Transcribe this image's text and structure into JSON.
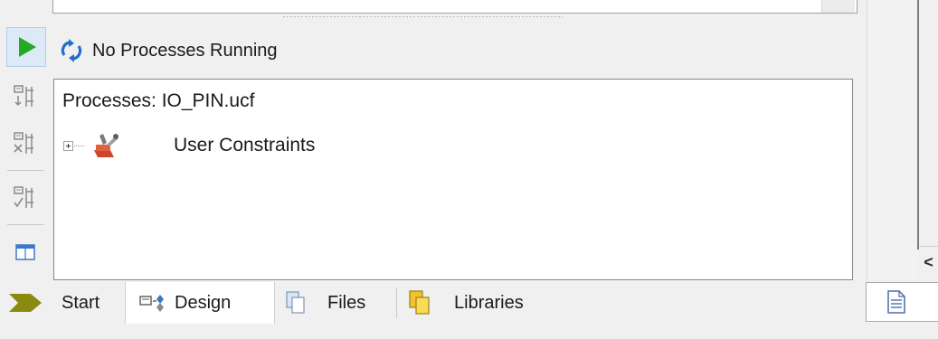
{
  "status": {
    "text": "No Processes Running",
    "icon": "refresh-icon"
  },
  "toolbar": {
    "items": [
      {
        "name": "run-button",
        "icon": "play-icon"
      },
      {
        "name": "rerun-button",
        "icon": "rerun-icon"
      },
      {
        "name": "rerun-all-button",
        "icon": "rerun-all-icon"
      },
      {
        "name": "stop-button",
        "icon": "stop-icon"
      },
      {
        "name": "view-button",
        "icon": "panel-icon"
      }
    ]
  },
  "processes": {
    "title": "Processes: IO_PIN.ucf",
    "items": [
      {
        "label": "User Constraints",
        "icon": "user-constraints-icon",
        "expanded": false
      }
    ]
  },
  "tabs": [
    {
      "label": "Start",
      "icon": "start-arrow-icon",
      "active": false
    },
    {
      "label": "Design",
      "icon": "design-icon",
      "active": true
    },
    {
      "label": "Files",
      "icon": "files-icon",
      "active": false
    },
    {
      "label": "Libraries",
      "icon": "libraries-icon",
      "active": false
    }
  ],
  "right_panel": {
    "scroll_left": "<",
    "doc_tab_icon": "document-icon"
  },
  "colors": {
    "play": "#22aa22",
    "start_arrow": "#8a8a10",
    "refresh": "#1f6fd0",
    "toolbox": "#d0442a",
    "panel_border": "#828790"
  }
}
